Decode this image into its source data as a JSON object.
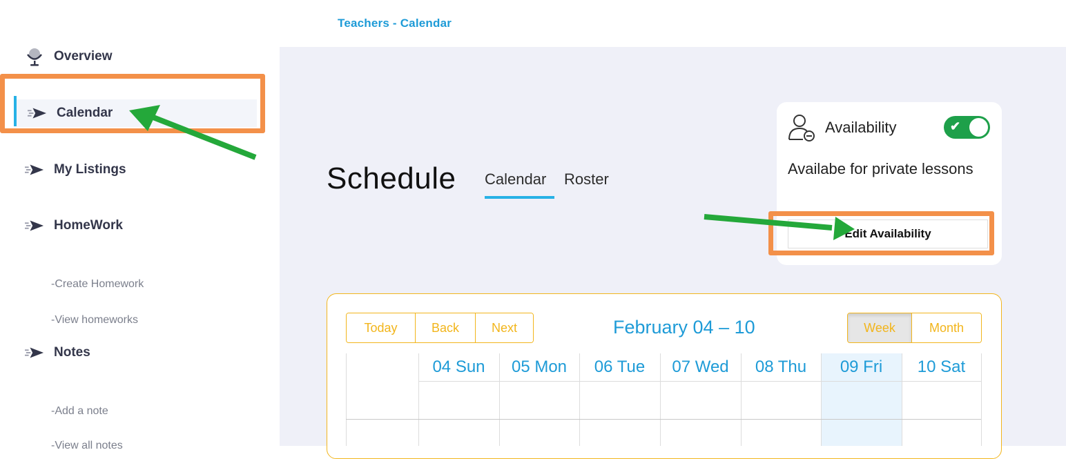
{
  "breadcrumb": "Teachers - Calendar",
  "sidebar": {
    "items": [
      {
        "label": "Overview",
        "icon": "microphone-icon"
      },
      {
        "label": "Calendar",
        "icon": "send-icon"
      },
      {
        "label": "My Listings",
        "icon": "send-icon"
      },
      {
        "label": "HomeWork",
        "icon": "send-icon"
      },
      {
        "label": "Notes",
        "icon": "send-icon"
      }
    ],
    "homework_sub": [
      "-Create Homework",
      "-View homeworks"
    ],
    "notes_sub": [
      "-Add a note",
      "-View all notes"
    ]
  },
  "main": {
    "title": "Schedule",
    "tabs": [
      "Calendar",
      "Roster"
    ],
    "active_tab": "Calendar"
  },
  "availability": {
    "title": "Availability",
    "toggle_on": true,
    "description": "Availabe for private lessons",
    "edit_button": "Edit Availability"
  },
  "calendar": {
    "nav_buttons": [
      "Today",
      "Back",
      "Next"
    ],
    "label": "February 04 – 10",
    "view_buttons": [
      "Week",
      "Month"
    ],
    "selected_view": "Week",
    "days": [
      "04 Sun",
      "05 Mon",
      "06 Tue",
      "07 Wed",
      "08 Thu",
      "09 Fri",
      "10 Sat"
    ],
    "today": "09 Fri"
  },
  "colors": {
    "accent": "#1e9bd7",
    "calendar_border": "#f2b51b",
    "toggle": "#1ea04a",
    "highlight": "#f39049",
    "annotation_arrow": "#24a83a"
  }
}
